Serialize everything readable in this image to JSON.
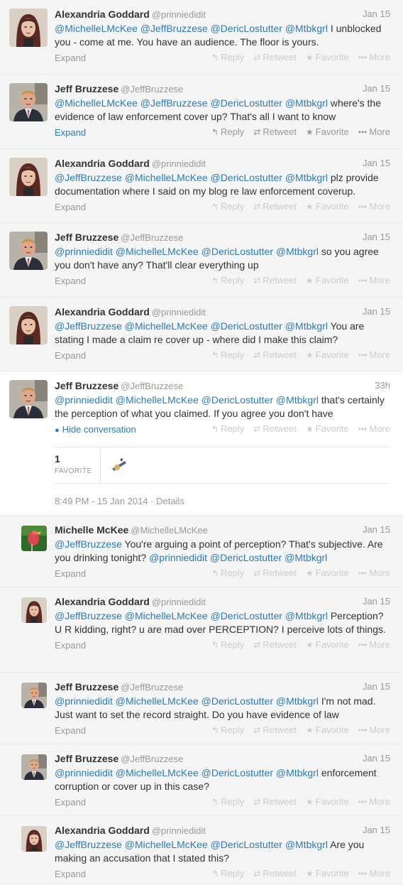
{
  "action_labels": {
    "reply": "Reply",
    "retweet": "Retweet",
    "favorite": "Favorite",
    "more": "More"
  },
  "icons": {
    "reply": "reply-arrow-icon",
    "retweet": "retweet-icon",
    "favorite": "star-icon",
    "more": "ellipsis-icon"
  },
  "colors": {
    "link": "#2b7bb9",
    "muted": "#999999",
    "faint": "#cccccc"
  },
  "tweets": [
    {
      "name": "Alexandria Goddard",
      "handle": "@prinniedidit",
      "time": "Jan 15",
      "t1": "@MichelleLMcKee @JeffBruzzese @DericLostutter @Mtbkgrl",
      "t2": " I unblocked you - come at me.  You have an audience. The floor is yours.",
      "expand": "Expand"
    },
    {
      "name": "Jeff Bruzzese",
      "handle": "@JeffBruzzese",
      "time": "Jan 15",
      "t1": "@MichelleLMcKee @JeffBruzzese @DericLostutter @Mtbkgrl",
      "t2": " where's the evidence of law enforcement cover up? That's all I want to know",
      "expand": "Expand"
    },
    {
      "name": "Alexandria Goddard",
      "handle": "@prinniedidit",
      "time": "Jan 15",
      "t1": "@JeffBruzzese @MichelleLMcKee @DericLostutter @Mtbkgrl",
      "t2": " plz provide documentation where I said on my blog re law enforcement coverup.",
      "expand": "Expand"
    },
    {
      "name": "Jeff Bruzzese",
      "handle": "@JeffBruzzese",
      "time": "Jan 15",
      "t1": "@prinniedidit @MichelleLMcKee @DericLostutter @Mtbkgrl",
      "t2": " so you agree you don't have any? That'll clear everything up",
      "expand": "Expand"
    },
    {
      "name": "Alexandria Goddard",
      "handle": "@prinniedidit",
      "time": "Jan 15",
      "t1": "@JeffBruzzese @MichelleLMcKee @DericLostutter @Mtbkgrl",
      "t2": " You are stating I made a claim re cover up - where did I make this claim?",
      "expand": "Expand"
    },
    {
      "name": "Jeff Bruzzese",
      "handle": "@JeffBruzzese",
      "time": "33h",
      "t1": "@prinniedidit @MichelleLMcKee @DericLostutter @Mtbkgrl",
      "t2": " that's certainly the perception of what you claimed. If you agree you don't have",
      "hide": "Hide conversation",
      "fav_count": "1",
      "fav_label": "FAVORITE",
      "meta": "8:49 PM - 15 Jan 2014 · Details"
    },
    {
      "name": "Michelle McKee",
      "handle": "@MichelleLMcKee",
      "time": "Jan 15",
      "t1": "@JeffBruzzese",
      "t2": " You're arguing a point of perception? That's subjective. Are you drinking tonight? ",
      "t3": "@prinniedidit @DericLostutter @Mtbkgrl",
      "expand": "Expand"
    },
    {
      "name": "Alexandria Goddard",
      "handle": "@prinniedidit",
      "time": "Jan 15",
      "t1": "@JeffBruzzese @MichelleLMcKee @DericLostutter @Mtbkgrl",
      "t2": " Perception? U R kidding, right? u are mad over PERCEPTION? I perceive lots of things.",
      "expand": "Expand"
    },
    {
      "name": "Jeff Bruzzese",
      "handle": "@JeffBruzzese",
      "time": "Jan 15",
      "t1": "@prinniedidit @MichelleLMcKee @DericLostutter @Mtbkgrl",
      "t2": " I'm not mad. Just want to set the record straight. Do you have evidence of law",
      "expand": "Expand"
    },
    {
      "name": "Jeff Bruzzese",
      "handle": "@JeffBruzzese",
      "time": "Jan 15",
      "t1": "@prinniedidit @MichelleLMcKee @DericLostutter @Mtbkgrl",
      "t2": " enforcement corruption or cover up in this case?",
      "expand": "Expand"
    },
    {
      "name": "Alexandria Goddard",
      "handle": "@prinniedidit",
      "time": "Jan 15",
      "t1": "@JeffBruzzese @MichelleLMcKee @DericLostutter @Mtbkgrl",
      "t2": " Are you making an accusation that I stated this?",
      "expand": "Expand"
    }
  ]
}
